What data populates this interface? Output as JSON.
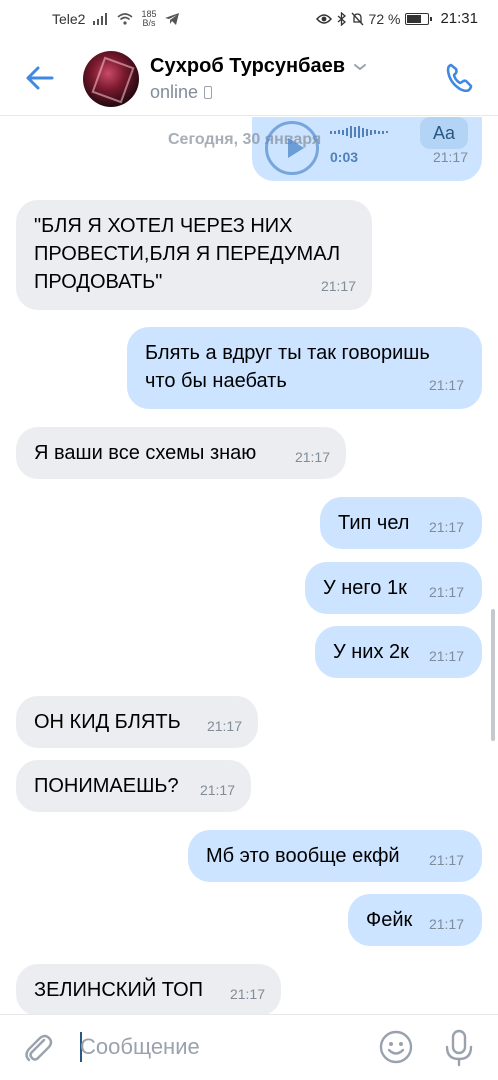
{
  "status_bar": {
    "carrier": "Tele2",
    "net_speed_value": "185",
    "net_speed_unit": "B/s",
    "battery": "72 %",
    "battery_level": 0.72,
    "time": "21:31"
  },
  "header": {
    "contact_name": "Сухроб Турсунбаев",
    "status": "online",
    "accent_color": "#2a5885"
  },
  "voice_message": {
    "date_divider": "Сегодня, 30 января",
    "duration": "0:03",
    "transcribe_label": "Aa",
    "time": "21:17"
  },
  "messages": [
    {
      "direction": "in",
      "lines": [
        "\"БЛЯ Я ХОТЕЛ ЧЕРЕЗ НИХ",
        "ПРОВЕСТИ,БЛЯ Я ПЕРЕДУМАЛ",
        "ПРОДОВАТЬ\""
      ],
      "time": "21:17"
    },
    {
      "direction": "out",
      "lines": [
        "Блять а вдруг ты так говоришь",
        "что бы наебать"
      ],
      "time": "21:17"
    },
    {
      "direction": "in",
      "lines": [
        "Я ваши все схемы знаю"
      ],
      "time": "21:17"
    },
    {
      "direction": "out",
      "lines": [
        "Тип чел"
      ],
      "time": "21:17"
    },
    {
      "direction": "out",
      "lines": [
        "У него 1к"
      ],
      "time": "21:17"
    },
    {
      "direction": "out",
      "lines": [
        "У них 2к"
      ],
      "time": "21:17"
    },
    {
      "direction": "in",
      "lines": [
        "ОН КИД БЛЯТЬ"
      ],
      "time": "21:17"
    },
    {
      "direction": "in",
      "lines": [
        "ПОНИМАЕШЬ?"
      ],
      "time": "21:17"
    },
    {
      "direction": "out",
      "lines": [
        "Мб это вообще екфй"
      ],
      "time": "21:17"
    },
    {
      "direction": "out",
      "lines": [
        "Фейк"
      ],
      "time": "21:17"
    },
    {
      "direction": "in",
      "lines": [
        "ЗЕЛИНСКИЙ ТОП"
      ],
      "time": "21:17"
    }
  ],
  "composer": {
    "placeholder": "Сообщение"
  },
  "colors": {
    "incoming_bubble": "#ebedf0",
    "outgoing_bubble": "#cce4ff",
    "time_text": "#818c99"
  }
}
